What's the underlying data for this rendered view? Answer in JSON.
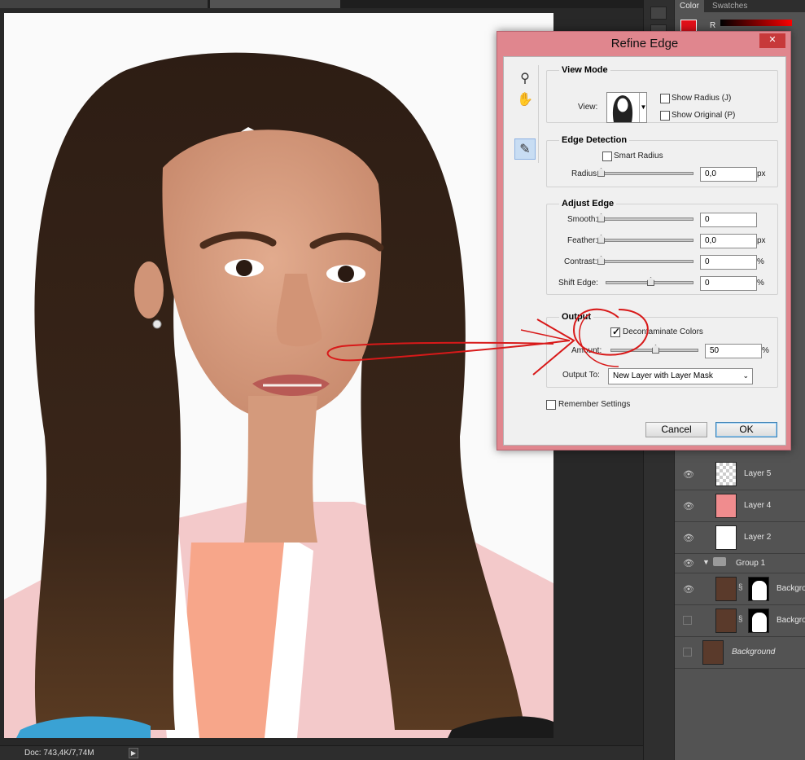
{
  "dialog": {
    "title": "Refine Edge",
    "close_label": "✕",
    "view_mode": {
      "legend": "View Mode",
      "view_label": "View:",
      "show_radius_label": "Show Radius (J)",
      "show_original_label": "Show Original (P)"
    },
    "edge_detection": {
      "legend": "Edge Detection",
      "smart_radius_label": "Smart Radius",
      "radius_label": "Radius:",
      "radius_value": "0,0",
      "radius_unit": "px"
    },
    "adjust_edge": {
      "legend": "Adjust Edge",
      "smooth_label": "Smooth:",
      "smooth_value": "0",
      "feather_label": "Feather:",
      "feather_value": "0,0",
      "feather_unit": "px",
      "contrast_label": "Contrast:",
      "contrast_value": "0",
      "contrast_unit": "%",
      "shift_edge_label": "Shift Edge:",
      "shift_edge_value": "0",
      "shift_edge_unit": "%"
    },
    "output": {
      "legend": "Output",
      "decontaminate_label": "Decontaminate Colors",
      "decontaminate_checked": true,
      "amount_label": "Amount:",
      "amount_value": "50",
      "amount_unit": "%",
      "output_to_label": "Output To:",
      "output_to_value": "New Layer with Layer Mask"
    },
    "remember_settings_label": "Remember Settings",
    "cancel_label": "Cancel",
    "ok_label": "OK"
  },
  "color_panel": {
    "tabs": [
      "Color",
      "Swatches"
    ],
    "r_label": "R",
    "foreground_color": "#e3101a"
  },
  "layers": [
    {
      "name": "Layer 5",
      "visible": true
    },
    {
      "name": "Layer 4",
      "visible": true
    },
    {
      "name": "Layer 2",
      "visible": true
    },
    {
      "name": "Group 1",
      "visible": true
    },
    {
      "name": "Backgro",
      "visible": true
    },
    {
      "name": "Backgro",
      "visible": false
    },
    {
      "name": "Background",
      "visible": false
    }
  ],
  "status": {
    "doc": "Doc: 743,4K/7,74M",
    "arrow": "▶"
  },
  "annotation_color": "#d81919"
}
